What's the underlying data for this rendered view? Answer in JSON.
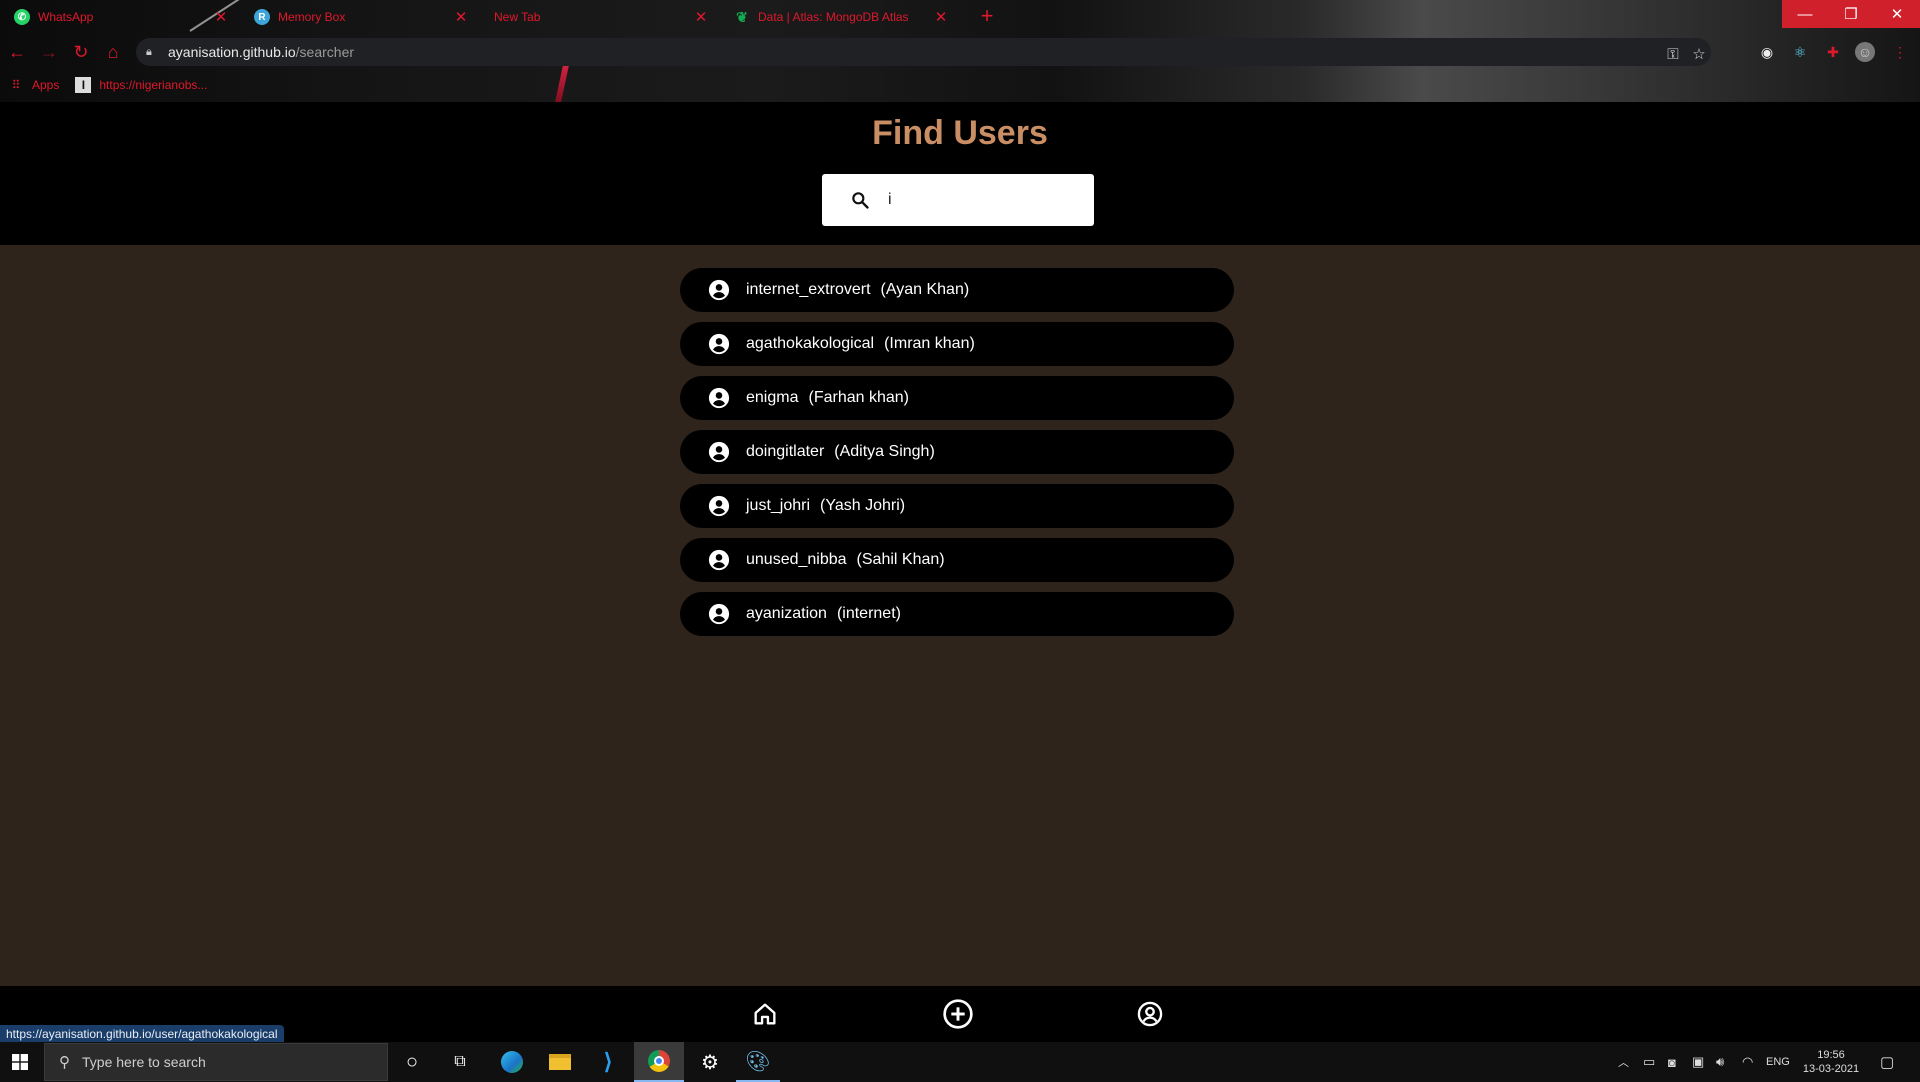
{
  "browser": {
    "tabs": [
      {
        "title": "WhatsApp",
        "favicon_color": "#25d366"
      },
      {
        "title": "Memory Box",
        "favicon_color": "#3da5d9"
      },
      {
        "title": "New Tab",
        "favicon_color": ""
      },
      {
        "title": "Data | Atlas: MongoDB Atlas",
        "favicon_color": "#13aa52"
      }
    ],
    "url_host": "ayanisation.github.io",
    "url_path": "/searcher",
    "bookmarks": [
      {
        "label": "Apps"
      },
      {
        "label": "https://nigerianobs..."
      }
    ],
    "accent_color": "#e0182c"
  },
  "page": {
    "title": "Find Users",
    "title_color": "#c98e64",
    "search": {
      "value": "i",
      "placeholder": ""
    },
    "results": [
      {
        "username": "internet_extrovert",
        "fullname": "(Ayan Khan)"
      },
      {
        "username": "agathokakological",
        "fullname": "(Imran khan)"
      },
      {
        "username": "enigma",
        "fullname": "(Farhan khan)"
      },
      {
        "username": "doingitlater",
        "fullname": "(Aditya Singh)"
      },
      {
        "username": "just_johri",
        "fullname": "(Yash Johri)"
      },
      {
        "username": "unused_nibba",
        "fullname": "(Sahil Khan)"
      },
      {
        "username": "ayanization",
        "fullname": "(internet)"
      }
    ],
    "bottom_nav": [
      "home-icon",
      "add-circle-icon",
      "account-circle-icon"
    ],
    "background_color": "#2f241c"
  },
  "status_bar": {
    "hover_url": "https://ayanisation.github.io/user/agathokakological"
  },
  "taskbar": {
    "search_placeholder": "Type here to search",
    "language": "ENG",
    "time": "19:56",
    "date": "13-03-2021"
  }
}
